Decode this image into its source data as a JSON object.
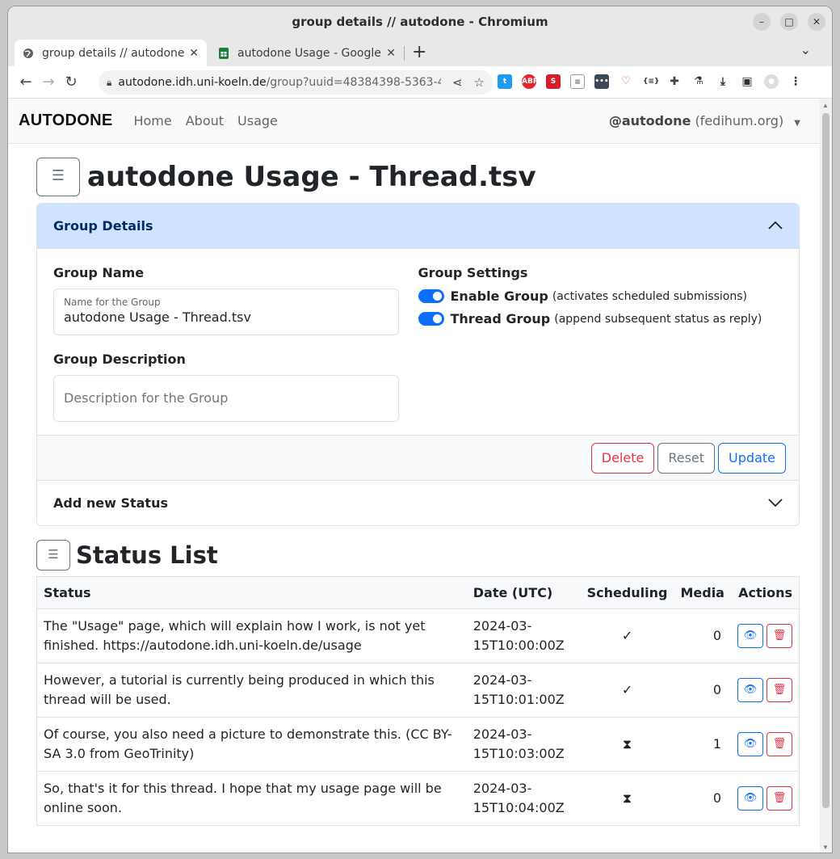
{
  "browser": {
    "window_title": "group details // autodone - Chromium",
    "tabs": [
      {
        "label": "group details // autodone"
      },
      {
        "label": "autodone Usage - Google"
      }
    ],
    "url_host": "autodone.idh.uni-koeln.de",
    "url_path": "/group?uuid=48384398-5363-4..."
  },
  "nav": {
    "brand": "AUTODONE",
    "links": [
      "Home",
      "About",
      "Usage"
    ],
    "user_handle": "@autodone",
    "user_instance": "(fedihum.org)"
  },
  "page": {
    "title": "autodone Usage - Thread.tsv"
  },
  "group_details": {
    "header": "Group Details",
    "name_label": "Group Name",
    "name_field_label": "Name for the Group",
    "name_value": "autodone Usage - Thread.tsv",
    "description_label": "Group Description",
    "description_placeholder": "Description for the Group",
    "settings_label": "Group Settings",
    "switches": [
      {
        "label": "Enable Group",
        "hint": "(activates scheduled submissions)",
        "checked": true
      },
      {
        "label": "Thread Group",
        "hint": "(append subsequent status as reply)",
        "checked": true
      }
    ],
    "buttons": {
      "delete": "Delete",
      "reset": "Reset",
      "update": "Update"
    }
  },
  "add_status": {
    "header": "Add new Status"
  },
  "status_list": {
    "title": "Status List",
    "columns": [
      "Status",
      "Date (UTC)",
      "Scheduling",
      "Media",
      "Actions"
    ],
    "rows": [
      {
        "status": "The \"Usage\" page, which will explain how I work, is not yet finished. https://autodone.idh.uni-koeln.de/usage",
        "date_1": "2024-03-",
        "date_2": "15T10:00:00Z",
        "scheduling": "✓",
        "media": "0"
      },
      {
        "status": "However, a tutorial is currently being produced in which this thread will be used.",
        "date_1": "2024-03-",
        "date_2": "15T10:01:00Z",
        "scheduling": "✓",
        "media": "0"
      },
      {
        "status": "Of course, you also need a picture to demonstrate this. (CC BY-SA 3.0 from GeoTrinity)",
        "date_1": "2024-03-",
        "date_2": "15T10:03:00Z",
        "scheduling": "⧗",
        "media": "1"
      },
      {
        "status": "So, that's it for this thread. I hope that my usage page will be online soon.",
        "date_1": "2024-03-",
        "date_2": "15T10:04:00Z",
        "scheduling": "⧗",
        "media": "0"
      }
    ]
  },
  "colors": {
    "primary": "#0d6efd",
    "danger": "#dc3545",
    "secondary": "#6c757d",
    "accordion_active_bg": "#cfe2ff"
  }
}
